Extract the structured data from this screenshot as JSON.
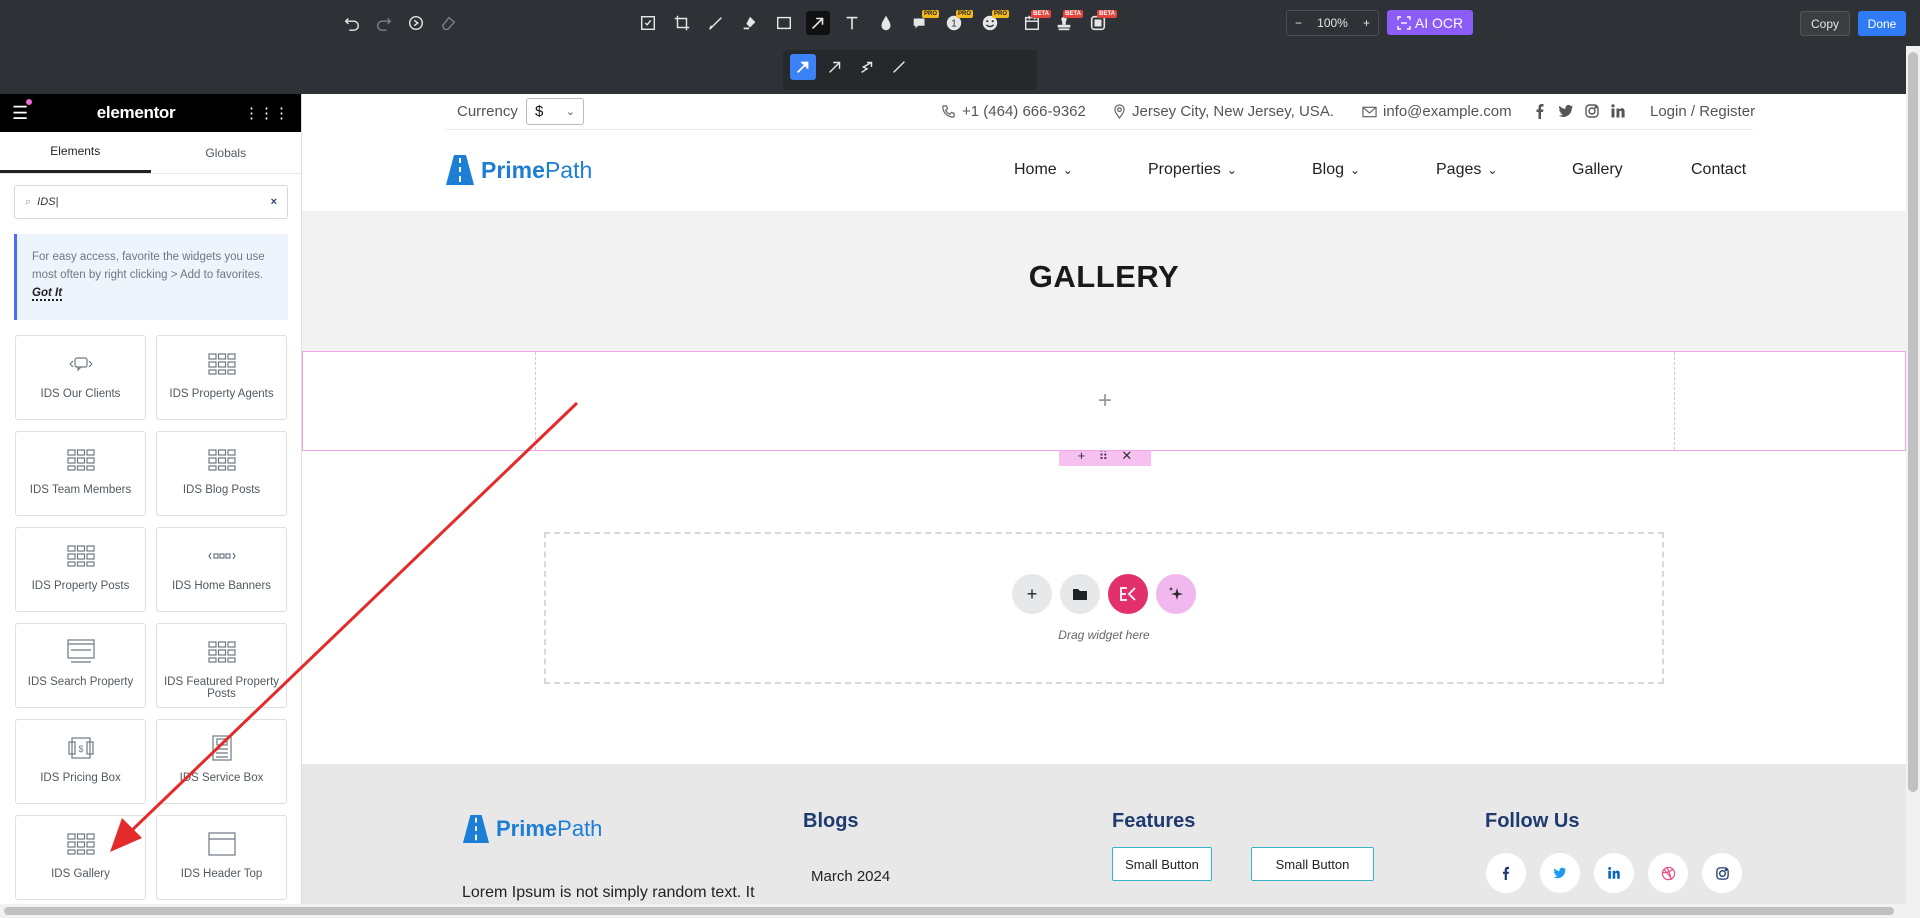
{
  "toolbar": {
    "zoom": "100%",
    "zoom_out": "−",
    "zoom_in": "+",
    "ai_ocr": "AI OCR",
    "copy": "Copy",
    "done": "Done",
    "badge_pro": "PRO",
    "badge_beta": "BETA",
    "stroke_size": "2"
  },
  "elementor": {
    "logo": "elementor",
    "tabs": [
      "Elements",
      "Globals"
    ],
    "search_value": "IDS|",
    "tip_text": "For easy access, favorite the widgets you use most often by right clicking > Add to favorites.",
    "tip_link": "Got It",
    "widgets": [
      "IDS Our Clients",
      "IDS Property Agents",
      "IDS Team Members",
      "IDS Blog Posts",
      "IDS Property Posts",
      "IDS Home Banners",
      "IDS Search Property",
      "IDS Featured Property Posts",
      "IDS Pricing Box",
      "IDS Service Box",
      "IDS Gallery",
      "IDS Header Top"
    ]
  },
  "site": {
    "currency_label": "Currency",
    "currency_value": "$",
    "phone": "+1 (464) 666-9362",
    "location": "Jersey City, New Jersey, USA.",
    "email": "info@example.com",
    "login": "Login / Register",
    "brand_bold": "Prime",
    "brand_light": "Path",
    "nav": [
      "Home",
      "Properties",
      "Blog",
      "Pages",
      "Gallery",
      "Contact"
    ],
    "page_title": "GALLERY",
    "drop_label": "Drag widget here",
    "footer": {
      "blogs": "Blogs",
      "features": "Features",
      "follow": "Follow Us",
      "text": "Lorem Ipsum is not simply random text. It",
      "date": "March 2024",
      "btn1": "Small Button",
      "btn2": "Small Button"
    }
  },
  "colors": {
    "toolbar_bg": "#2e3136",
    "accent_blue": "#2f7cf6",
    "ai_purple": "#8b5cf6",
    "annotation_red": "#e42b2b",
    "brand_blue": "#1d7ed6",
    "section_pink": "#f3a3e6"
  }
}
